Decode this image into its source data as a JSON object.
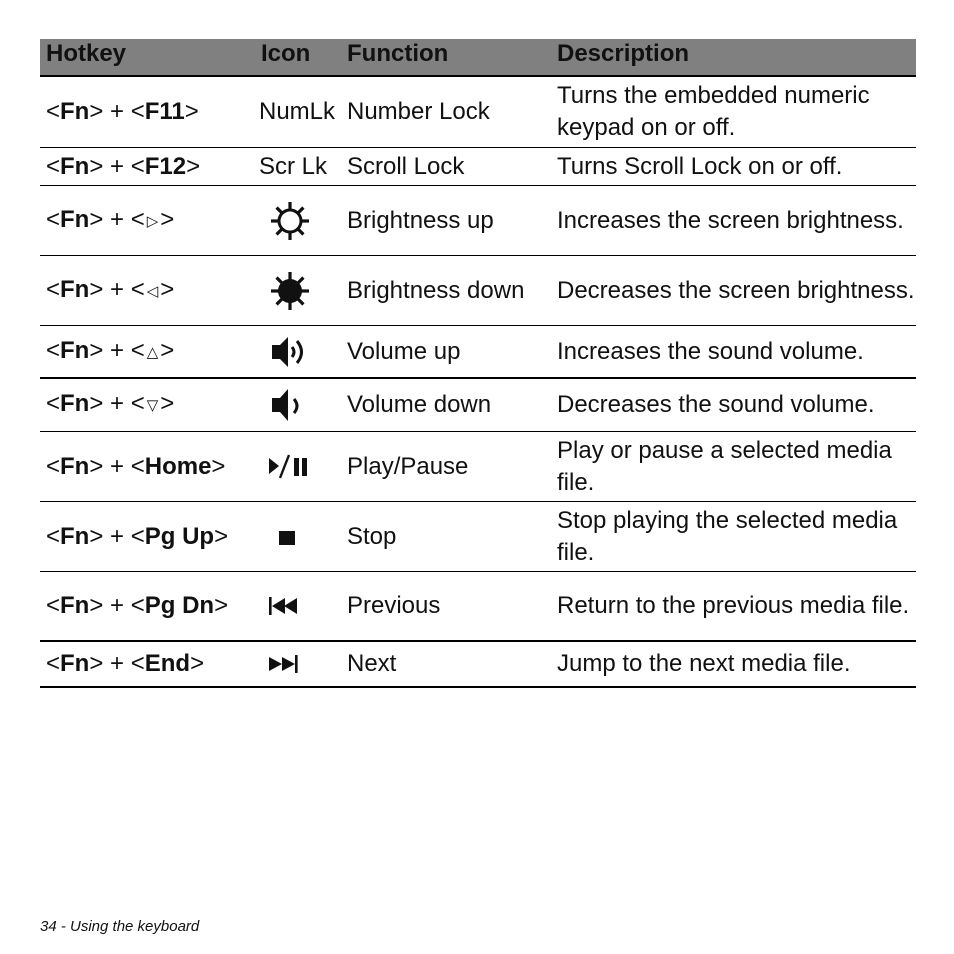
{
  "table": {
    "headers": {
      "hotkey": "Hotkey",
      "icon": "Icon",
      "function": "Function",
      "description": "Description"
    },
    "rows": [
      {
        "mod": "Fn",
        "key": "F11",
        "key_bold": true,
        "icon_text": "NumLk",
        "icon": "",
        "function": "Number Lock",
        "description": "Turns the embedded numeric keypad on or off."
      },
      {
        "mod": "Fn",
        "key": "F12",
        "key_bold": true,
        "icon_text": "Scr Lk",
        "icon": "",
        "function": "Scroll Lock",
        "description": "Turns Scroll Lock on or off."
      },
      {
        "mod": "Fn",
        "key": "▷",
        "key_bold": false,
        "icon_text": "",
        "icon": "brightness-up-icon",
        "function": "Brightness up",
        "description": "Increases the screen brightness."
      },
      {
        "mod": "Fn",
        "key": "◁",
        "key_bold": false,
        "icon_text": "",
        "icon": "brightness-down-icon",
        "function": "Brightness down",
        "description": "Decreases the screen brightness."
      },
      {
        "mod": "Fn",
        "key": "△",
        "key_bold": false,
        "icon_text": "",
        "icon": "volume-up-icon",
        "function": "Volume up",
        "description": "Increases the sound volume."
      },
      {
        "mod": "Fn",
        "key": "▽",
        "key_bold": false,
        "icon_text": "",
        "icon": "volume-down-icon",
        "function": "Volume down",
        "description": "Decreases the sound volume."
      },
      {
        "mod": "Fn",
        "key": "Home",
        "key_bold": true,
        "icon_text": "",
        "icon": "play-pause-icon",
        "function": "Play/Pause",
        "description": "Play or pause a selected media file."
      },
      {
        "mod": "Fn",
        "key": "Pg Up",
        "key_bold": true,
        "icon_text": "",
        "icon": "stop-icon",
        "function": "Stop",
        "description": "Stop playing the selected media file."
      },
      {
        "mod": "Fn",
        "key": "Pg Dn",
        "key_bold": true,
        "icon_text": "",
        "icon": "previous-icon",
        "function": "Previous",
        "description": "Return to the previous media file."
      },
      {
        "mod": "Fn",
        "key": "End",
        "key_bold": true,
        "icon_text": "",
        "icon": "next-icon",
        "function": "Next",
        "description": "Jump to the next media file."
      }
    ]
  },
  "symbols": {
    "lt": "<",
    "gt": ">",
    "plus": " + "
  },
  "footer": {
    "text": "34 - Using the keyboard"
  },
  "colors": {
    "header_bg": "#808080",
    "text": "#111111",
    "rule": "#000000"
  }
}
